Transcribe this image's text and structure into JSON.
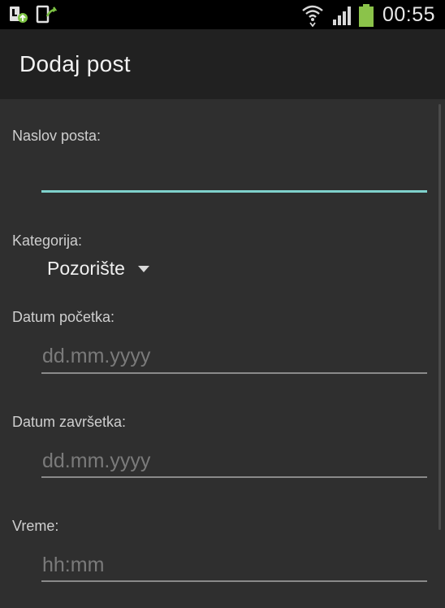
{
  "status_bar": {
    "time": "00:55",
    "icons": [
      "usb-notification-icon",
      "download-notification-icon",
      "wifi-icon",
      "signal-icon",
      "battery-icon"
    ],
    "battery_color": "#8bc34a"
  },
  "action_bar": {
    "title": "Dodaj post"
  },
  "form": {
    "title_field": {
      "label": "Naslov posta:",
      "value": "",
      "placeholder": ""
    },
    "category": {
      "label": "Kategorija:",
      "selected": "Pozorište"
    },
    "start_date": {
      "label": "Datum početka:",
      "value": "",
      "placeholder": "dd.mm.yyyy"
    },
    "end_date": {
      "label": "Datum završetka:",
      "value": "",
      "placeholder": "dd.mm.yyyy"
    },
    "time": {
      "label": "Vreme:",
      "value": "",
      "placeholder": "hh:mm"
    }
  },
  "colors": {
    "accent_focus": "#7fd1cc",
    "background": "#2f2f2f",
    "action_bar": "#212121"
  }
}
